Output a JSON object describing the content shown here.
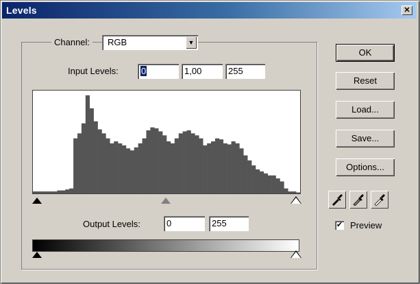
{
  "window": {
    "title": "Levels",
    "close_glyph": "✕"
  },
  "channel": {
    "label": "Channel:",
    "value": "RGB",
    "arrow_glyph": "▼"
  },
  "input_levels": {
    "label": "Input Levels:",
    "black": "0",
    "gamma": "1,00",
    "white": "255"
  },
  "output_levels": {
    "label": "Output Levels:",
    "black": "0",
    "white": "255"
  },
  "histogram": {
    "bins": [
      0.02,
      0.02,
      0.02,
      0.02,
      0.02,
      0.02,
      0.03,
      0.03,
      0.04,
      0.05,
      0.55,
      0.6,
      0.7,
      0.98,
      0.85,
      0.72,
      0.64,
      0.6,
      0.55,
      0.5,
      0.52,
      0.5,
      0.48,
      0.45,
      0.43,
      0.46,
      0.5,
      0.55,
      0.63,
      0.66,
      0.65,
      0.62,
      0.58,
      0.52,
      0.5,
      0.55,
      0.6,
      0.62,
      0.63,
      0.6,
      0.58,
      0.55,
      0.48,
      0.5,
      0.52,
      0.55,
      0.54,
      0.5,
      0.49,
      0.52,
      0.5,
      0.45,
      0.38,
      0.33,
      0.28,
      0.24,
      0.22,
      0.2,
      0.18,
      0.18,
      0.15,
      0.12,
      0.05,
      0.02,
      0.02,
      0.01
    ],
    "color": "#555555"
  },
  "buttons": {
    "ok": "OK",
    "reset": "Reset",
    "load": "Load...",
    "save": "Save...",
    "options": "Options..."
  },
  "preview": {
    "label": "Preview",
    "checked": true,
    "check_glyph": "✔"
  },
  "eyedroppers": [
    "black-point-eyedropper-icon",
    "gray-point-eyedropper-icon",
    "white-point-eyedropper-icon"
  ]
}
